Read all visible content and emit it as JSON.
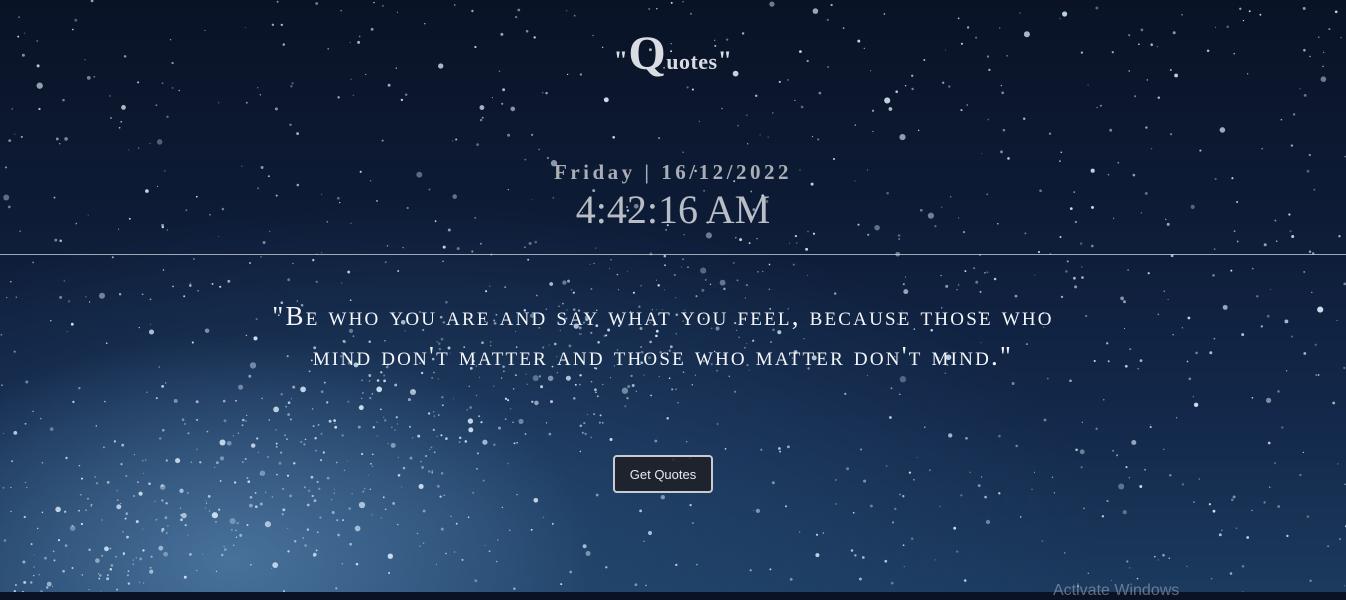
{
  "app": {
    "title_open": "\"",
    "title_big": "Q",
    "title_small": "uotes",
    "title_close": "\""
  },
  "clock": {
    "date": "Friday | 16/12/2022",
    "time": "4:42:16 AM"
  },
  "quote": {
    "text": "\"Be who you are and say what you feel, because those who mind don't matter and those who matter don't mind.\""
  },
  "actions": {
    "get_quotes_label": "Get Quotes"
  },
  "overlay": {
    "watermark": "Activate Windows"
  },
  "colors": {
    "background_top": "#0a1326",
    "background_bottom": "#1b3a5e",
    "star": "#cfe0f2",
    "text": "#e9edf3",
    "button_border": "#c7ccd4"
  }
}
